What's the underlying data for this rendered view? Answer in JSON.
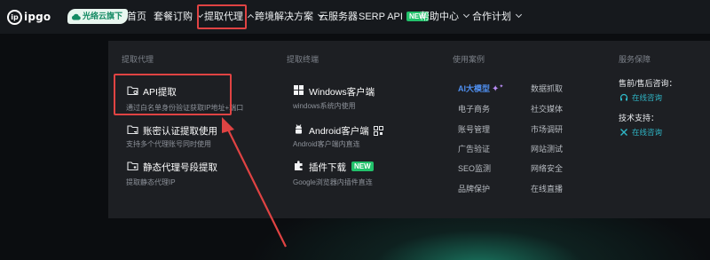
{
  "brand": {
    "logo_mark": "ip",
    "logo_text": "ipgo",
    "badge": "光络云旗下"
  },
  "nav": {
    "home": "首页",
    "plans": "套餐订购",
    "proxy": "提取代理",
    "cross_border": "跨境解决方案",
    "cloud_server": "云服务器",
    "serp_api": "SERP API",
    "serp_badge": "NEW",
    "help": "帮助中心",
    "partner": "合作计划"
  },
  "dropdown": {
    "col1": {
      "title": "提取代理",
      "items": [
        {
          "label": "API提取",
          "desc": "通过白名单身份验证获取IP地址+端口"
        },
        {
          "label": "账密认证提取使用",
          "desc": "支持多个代理账号同时使用"
        },
        {
          "label": "静态代理号段提取",
          "desc": "提取静态代理IP"
        }
      ]
    },
    "col2": {
      "title": "提取终端",
      "items": [
        {
          "label": "Windows客户端",
          "desc": "windows系统内使用"
        },
        {
          "label": "Android客户端",
          "desc": "Android客户端内直连"
        },
        {
          "label": "插件下载",
          "desc": "Google浏览器内插件直连",
          "badge": "NEW"
        }
      ]
    },
    "col3": {
      "title": "使用案例",
      "left": [
        "AI大模型",
        "电子商务",
        "账号管理",
        "广告验证",
        "SEO监测",
        "品牌保护"
      ],
      "right": [
        "数据抓取",
        "社交媒体",
        "市场调研",
        "网站测试",
        "网络安全",
        "在线直播"
      ]
    },
    "col4": {
      "title": "服务保障",
      "presale_label": "售前/售后咨询：",
      "presale_link": "在线咨询",
      "tech_label": "技术支持：",
      "tech_link": "在线咨询"
    }
  },
  "colors": {
    "accent_red": "#e04343",
    "new_green": "#22c26b",
    "link_teal": "#2fb6c6",
    "ai_blue": "#4f8ff0"
  }
}
